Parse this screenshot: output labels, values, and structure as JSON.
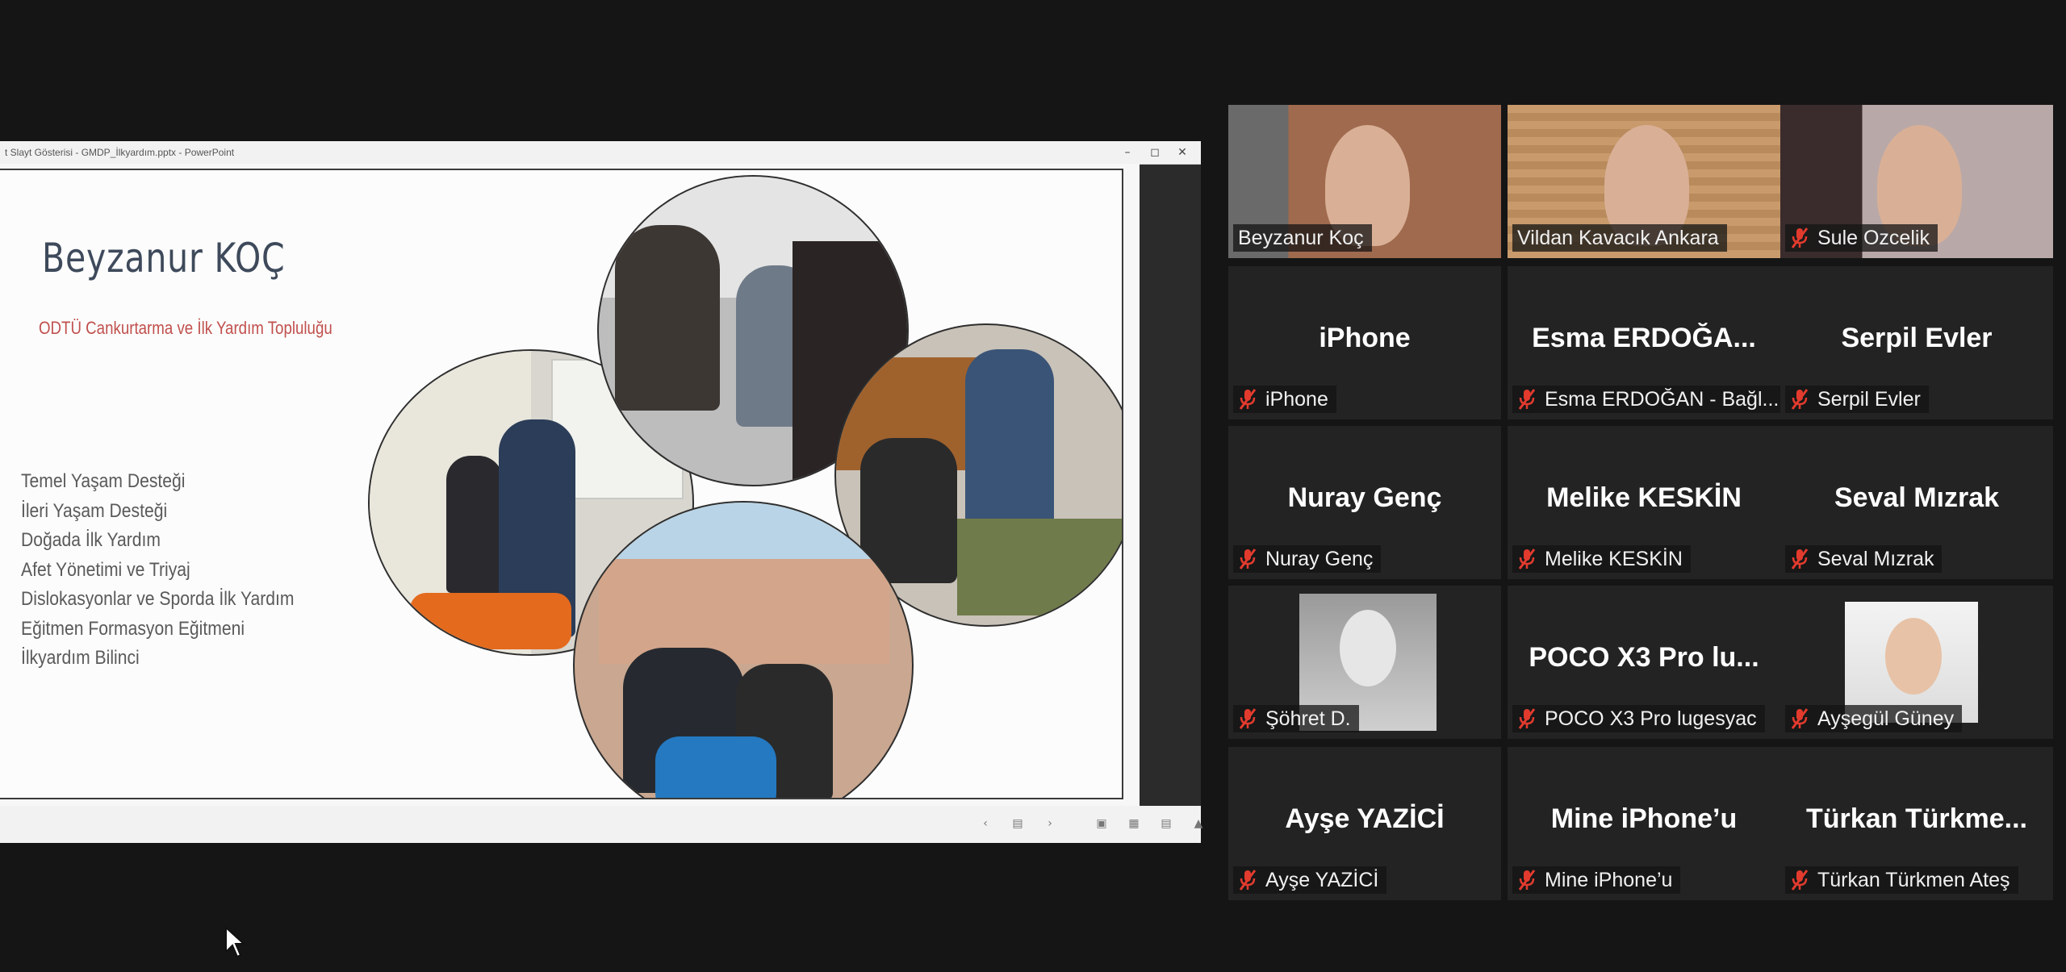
{
  "powerpoint": {
    "title_bar": "t Slayt Gösterisi - GMDP_İlkyardım.pptx - PowerPoint",
    "window_controls": [
      "minimize-icon",
      "maximize-icon",
      "close-icon"
    ],
    "slide": {
      "name": "Beyzanur KOÇ",
      "organization": "ODTÜ Cankurtarma ve İlk Yardım Topluluğu",
      "topics": [
        "Temel Yaşam Desteği",
        "İleri Yaşam Desteği",
        "Doğada İlk Yardım",
        "Afet Yönetimi ve Triyaj",
        "Dislokasyonlar ve Sporda İlk Yardım",
        "Eğitmen Formasyon Eğitmeni",
        "İlkyardım Bilinci"
      ]
    },
    "status_icons": [
      "prev-slide-icon",
      "slide-sorter-icon",
      "next-slide-icon",
      "normal-view-icon",
      "sorter-view-icon",
      "reading-view-icon",
      "presenter-view-icon"
    ]
  },
  "gallery": {
    "accent_color": "#c7e89a",
    "mute_color": "#e23b2e",
    "participants": [
      {
        "display": "",
        "label": "Beyzanur Koç",
        "muted": false,
        "video": true,
        "active": true
      },
      {
        "display": "",
        "label": "Vildan Kavacık Ankara",
        "muted": false,
        "video": true
      },
      {
        "display": "",
        "label": "Sule Ozcelik",
        "muted": true,
        "video": true
      },
      {
        "display": "iPhone",
        "label": "iPhone",
        "muted": true,
        "video": false
      },
      {
        "display": "Esma  ERDOĞA...",
        "label": "Esma ERDOĞAN - Bağl...",
        "muted": true,
        "video": false
      },
      {
        "display": "Serpil Evler",
        "label": "Serpil Evler",
        "muted": true,
        "video": false
      },
      {
        "display": "Nuray Genç",
        "label": "Nuray Genç",
        "muted": true,
        "video": false
      },
      {
        "display": "Melike KESKİN",
        "label": "Melike KESKİN",
        "muted": true,
        "video": false
      },
      {
        "display": "Seval Mızrak",
        "label": "Seval Mızrak",
        "muted": true,
        "video": false
      },
      {
        "display": "",
        "label": "Şöhret D.",
        "muted": true,
        "video": false,
        "photo": true
      },
      {
        "display": "POCO X3 Pro lu...",
        "label": "POCO X3 Pro lugesyac",
        "muted": true,
        "video": false
      },
      {
        "display": "",
        "label": "Ayşegül Güney",
        "muted": true,
        "video": false,
        "photo": true
      },
      {
        "display": "Ayşe YAZİCİ",
        "label": "Ayşe YAZİCİ",
        "muted": true,
        "video": false
      },
      {
        "display": "Mine iPhone’u",
        "label": "Mine iPhone’u",
        "muted": true,
        "video": false
      },
      {
        "display": "Türkan  Türkme...",
        "label": "Türkan Türkmen Ateş",
        "muted": true,
        "video": false
      }
    ]
  }
}
